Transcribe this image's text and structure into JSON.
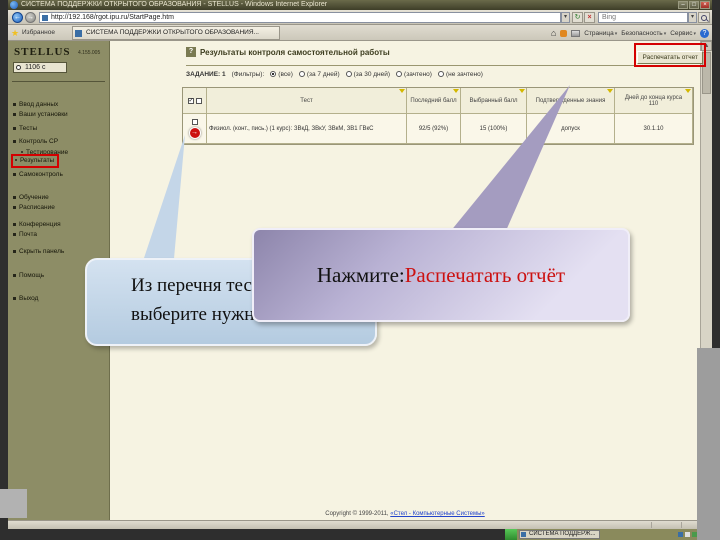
{
  "titlebar": {
    "title": "СИСТЕМА ПОДДЕРЖКИ ОТКРЫТОГО ОБРАЗОВАНИЯ - STELLUS - Windows Internet Explorer"
  },
  "navigation": {
    "url": "http://192.168/rgot.ipu.ru/StartPage.htm",
    "search_value": "Bing"
  },
  "favorites_bar": {
    "favorites_label": "Избранное",
    "tab_title": "СИСТЕМА ПОДДЕРЖКИ ОТКРЫТОГО ОБРАЗОВАНИЯ...",
    "page_menu": "Страница",
    "safety_menu": "Безопасность",
    "tools_menu": "Сервис"
  },
  "sidebar": {
    "logo": "STELLUS",
    "version": "4.155.005",
    "timer": "1106 с",
    "items": [
      {
        "label": "Ввод данных"
      },
      {
        "label": "Ваши установки"
      },
      {
        "label": "Тесты"
      },
      {
        "label": "Контроль СР"
      },
      {
        "label": "Тестирование"
      },
      {
        "label": "Результаты"
      },
      {
        "label": "Самоконтроль"
      },
      {
        "label": "Обучение"
      },
      {
        "label": "Расписание"
      },
      {
        "label": "Конференция"
      },
      {
        "label": "Почта"
      },
      {
        "label": "Скрыть панель"
      },
      {
        "label": "Помощь"
      },
      {
        "label": "Выход"
      }
    ]
  },
  "report": {
    "title": "Результаты контроля самостоятельной работы",
    "print_button": "Распечатать отчет",
    "task_label": "ЗАДАНИЕ: 1",
    "filters_label": "(Фильтры):",
    "filter_options": [
      "(все)",
      "(за 7 дней)",
      "(за 30 дней)",
      "(зачтено)",
      "(не зачтено)"
    ],
    "table": {
      "col_test": "Тест",
      "col_last_score": "Последний балл",
      "col_selected_score": "Выбранный балл",
      "col_confirmed": "Подтвержденные знания",
      "col_days": "Дней до конца курса",
      "days_value": "110",
      "row": {
        "test": "Физиол. (конт., пись.) (1 курс): ЗВкД, ЗВкУ, ЗВкМ, ЗВ1 ГВкС",
        "last_score": "92/5 (92%)",
        "selected_score": "15 (100%)",
        "confirmed": "допуск",
        "date": "30.1.10"
      }
    },
    "footer": {
      "copyright": "Copyright © 1999-2011,",
      "link": "«Стел - Компьютерные Системы»"
    }
  },
  "callouts": {
    "select_test_line1": "Из перечня тестов",
    "select_test_line2": "выберите нужный",
    "print_prefix": "Нажмите: ",
    "print_action": "Распечатать отчёт"
  },
  "taskbar": {
    "window_button": "СИСТЕМА ПОДДЕРЖ..."
  },
  "colors": {
    "accent_red": "#d40000",
    "sidebar_olive": "#8d8d66",
    "content_beige": "#f6f3e2"
  }
}
